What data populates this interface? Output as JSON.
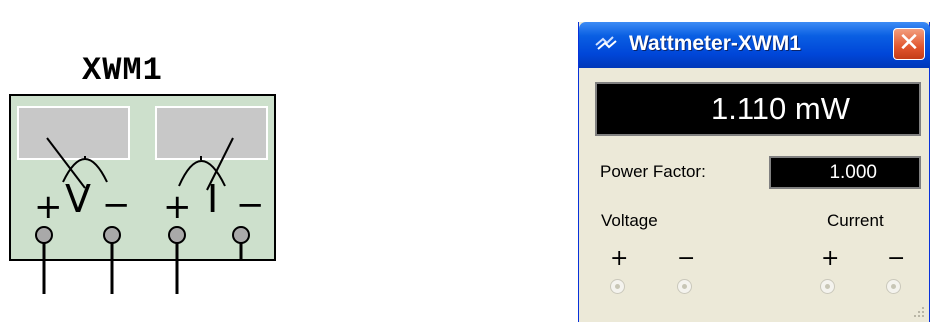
{
  "schematic": {
    "ref": "XWM1",
    "voltage_letter": "V",
    "current_letter": "I",
    "plus": "+",
    "minus": "−"
  },
  "window": {
    "title": "Wattmeter-XWM1",
    "close_label": "✕",
    "reading": "1.110 mW",
    "power_factor_label": "Power Factor:",
    "power_factor_value": "1.000",
    "voltage_label": "Voltage",
    "current_label": "Current",
    "plus": "+",
    "minus": "−"
  },
  "colors": {
    "symbol_fill": "#cde0cc",
    "meter_face": "#c8c8c8",
    "titlebar": "#0a5fe3",
    "close_button": "#e2562e",
    "display_bg": "#000000",
    "window_bg": "#ece9d8"
  },
  "icons": {
    "title_icon": "wattmeter-probe-icon",
    "close_icon": "close-icon",
    "resize_icon": "resize-grip-icon"
  }
}
